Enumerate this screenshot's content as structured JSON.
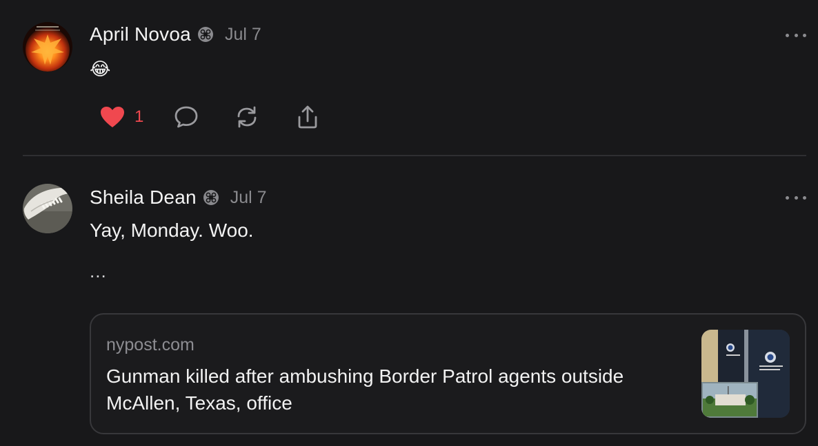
{
  "posts": [
    {
      "author": "April Novoa",
      "date": "Jul 7",
      "body": "😂",
      "actions": {
        "like_count": "1"
      },
      "icons": [
        "avatar-phoenix",
        "verified-icon",
        "more-icon",
        "heart-icon",
        "comment-icon",
        "repost-icon",
        "share-icon"
      ]
    },
    {
      "author": "Sheila Dean",
      "date": "Jul 7",
      "body": "Yay, Monday. Woo.",
      "truncation": "...",
      "link_card": {
        "domain": "nypost.com",
        "title": "Gunman killed after ambushing Border Patrol agents outside McAllen, Texas, office"
      },
      "icons": [
        "avatar-jaw",
        "verified-icon",
        "more-icon"
      ]
    }
  ],
  "colors": {
    "background": "#18181a",
    "like_active": "#f0484f",
    "muted_text": "#8a8a8e",
    "divider": "#2f2f32"
  }
}
